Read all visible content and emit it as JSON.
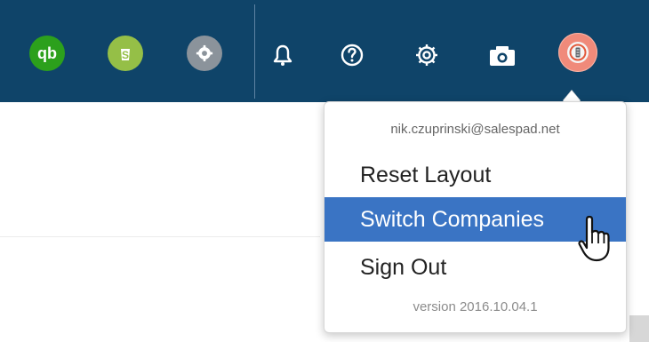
{
  "header": {
    "apps": [
      {
        "name": "quickbooks",
        "icon": "quickbooks-icon",
        "color": "#2ca01c",
        "text": "qb"
      },
      {
        "name": "shopify",
        "icon": "shopify-icon",
        "color": "#95bf47",
        "text": "S"
      },
      {
        "name": "settings-app",
        "icon": "settings-icon",
        "color": "#8b939b"
      }
    ],
    "actions": [
      {
        "name": "notifications",
        "icon": "bell-icon"
      },
      {
        "name": "help",
        "icon": "help-icon"
      },
      {
        "name": "settings",
        "icon": "gear-icon"
      },
      {
        "name": "camera",
        "icon": "camera-icon"
      }
    ],
    "profile": {
      "icon": "avatar-icon",
      "color": "#f08a7a"
    }
  },
  "account_menu": {
    "email": "nik.czuprinski@salespad.net",
    "items": [
      "Reset Layout",
      "Switch Companies",
      "Sign Out"
    ],
    "version": "version 2016.10.04.1",
    "active_item": "Switch Companies"
  }
}
